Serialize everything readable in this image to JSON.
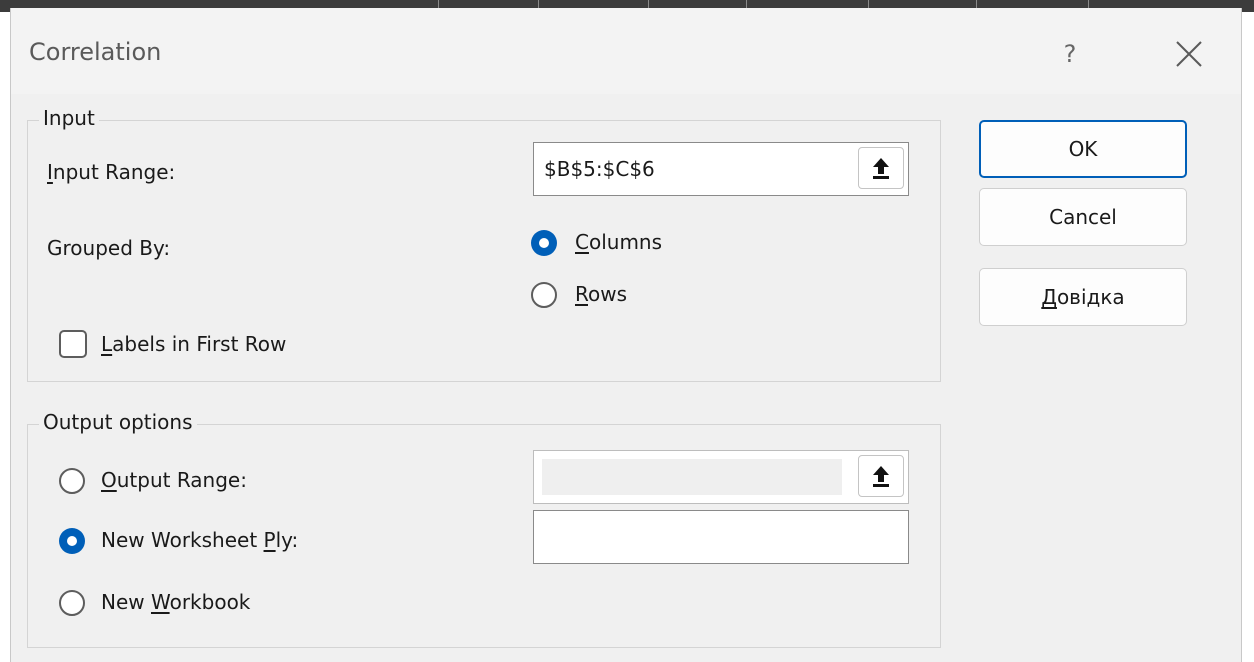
{
  "window": {
    "title": "Correlation",
    "help_glyph": "?",
    "close_icon": "close-icon"
  },
  "input_group": {
    "legend": "Input",
    "input_range": {
      "label_mnemonic": "I",
      "label_rest": "nput Range:",
      "value": "$B$5:$C$6"
    },
    "grouped_by": {
      "label": "Grouped By:",
      "columns": {
        "mnemonic": "C",
        "rest": "olumns",
        "checked": true
      },
      "rows": {
        "mnemonic": "R",
        "rest": "ows",
        "checked": false
      }
    },
    "labels_first_row": {
      "mnemonic": "L",
      "rest": "abels in First Row",
      "checked": false
    }
  },
  "output_group": {
    "legend": "Output options",
    "output_range": {
      "before": "",
      "mnemonic": "O",
      "rest": "utput Range:",
      "checked": false,
      "value": ""
    },
    "new_worksheet": {
      "before": "New Worksheet ",
      "mnemonic": "P",
      "rest": "ly:",
      "checked": true,
      "value": ""
    },
    "new_workbook": {
      "before": "New ",
      "mnemonic": "W",
      "rest": "orkbook",
      "checked": false
    }
  },
  "buttons": {
    "ok": "OK",
    "cancel": "Cancel",
    "help_mnemonic": "Д",
    "help_rest": "овідка"
  },
  "colors": {
    "accent": "#005fb8",
    "dialog_bg": "#f0f0f0"
  },
  "icons": {
    "range_collapse": "upload-arrow-icon"
  }
}
